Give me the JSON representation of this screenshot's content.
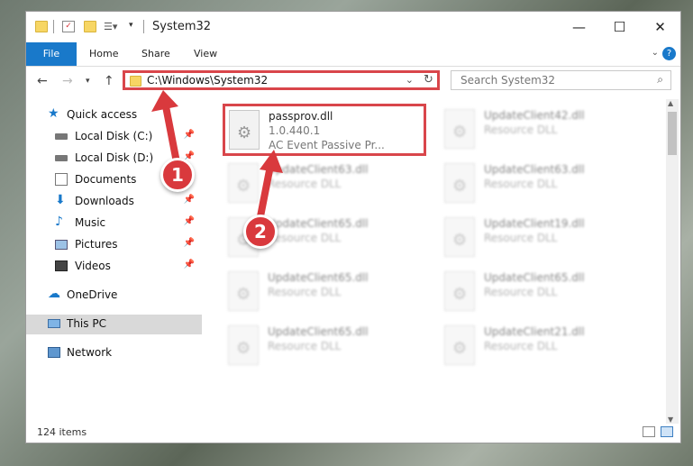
{
  "window": {
    "title": "System32",
    "controls": {
      "minimize": "—",
      "maximize": "☐",
      "close": "✕"
    }
  },
  "ribbon": {
    "tabs": [
      "File",
      "Home",
      "Share",
      "View"
    ],
    "help": "?"
  },
  "nav": {
    "address": "C:\\Windows\\System32",
    "search_placeholder": "Search System32"
  },
  "sidebar": {
    "items": [
      {
        "label": "Quick access",
        "icon": "star-icon",
        "pinned": false
      },
      {
        "label": "Local Disk (C:)",
        "icon": "drive-icon",
        "pinned": true
      },
      {
        "label": "Local Disk (D:)",
        "icon": "drive-icon",
        "pinned": true
      },
      {
        "label": "Documents",
        "icon": "documents-icon",
        "pinned": true
      },
      {
        "label": "Downloads",
        "icon": "download-icon",
        "pinned": true
      },
      {
        "label": "Music",
        "icon": "music-icon",
        "pinned": true
      },
      {
        "label": "Pictures",
        "icon": "pictures-icon",
        "pinned": true
      },
      {
        "label": "Videos",
        "icon": "videos-icon",
        "pinned": true
      },
      {
        "label": "OneDrive",
        "icon": "cloud-icon",
        "pinned": false
      },
      {
        "label": "This PC",
        "icon": "computer-icon",
        "pinned": false,
        "selected": true
      },
      {
        "label": "Network",
        "icon": "network-icon",
        "pinned": false
      }
    ]
  },
  "files": [
    {
      "name": "passprov.dll",
      "line1": "1.0.440.1",
      "line2": "AC Event Passive Pr...",
      "highlighted": true
    },
    {
      "name": "UpdateClient42.dll",
      "line1": "Resource DLL",
      "line2": ""
    },
    {
      "name": "UpdateClient63.dll",
      "line1": "Resource DLL",
      "line2": ""
    },
    {
      "name": "UpdateClient63.dll",
      "line1": "Resource DLL",
      "line2": ""
    },
    {
      "name": "UpdateClient65.dll",
      "line1": "Resource DLL",
      "line2": ""
    },
    {
      "name": "UpdateClient19.dll",
      "line1": "Resource DLL",
      "line2": ""
    },
    {
      "name": "UpdateClient65.dll",
      "line1": "Resource DLL",
      "line2": ""
    },
    {
      "name": "UpdateClient65.dll",
      "line1": "Resource DLL",
      "line2": ""
    },
    {
      "name": "UpdateClient65.dll",
      "line1": "Resource DLL",
      "line2": ""
    },
    {
      "name": "UpdateClient21.dll",
      "line1": "Resource DLL",
      "line2": ""
    }
  ],
  "status": {
    "item_count": "124 items"
  },
  "callouts": [
    "1",
    "2"
  ],
  "colors": {
    "accent": "#1979ca",
    "highlight": "#d9464b",
    "callout": "#d9393d"
  }
}
